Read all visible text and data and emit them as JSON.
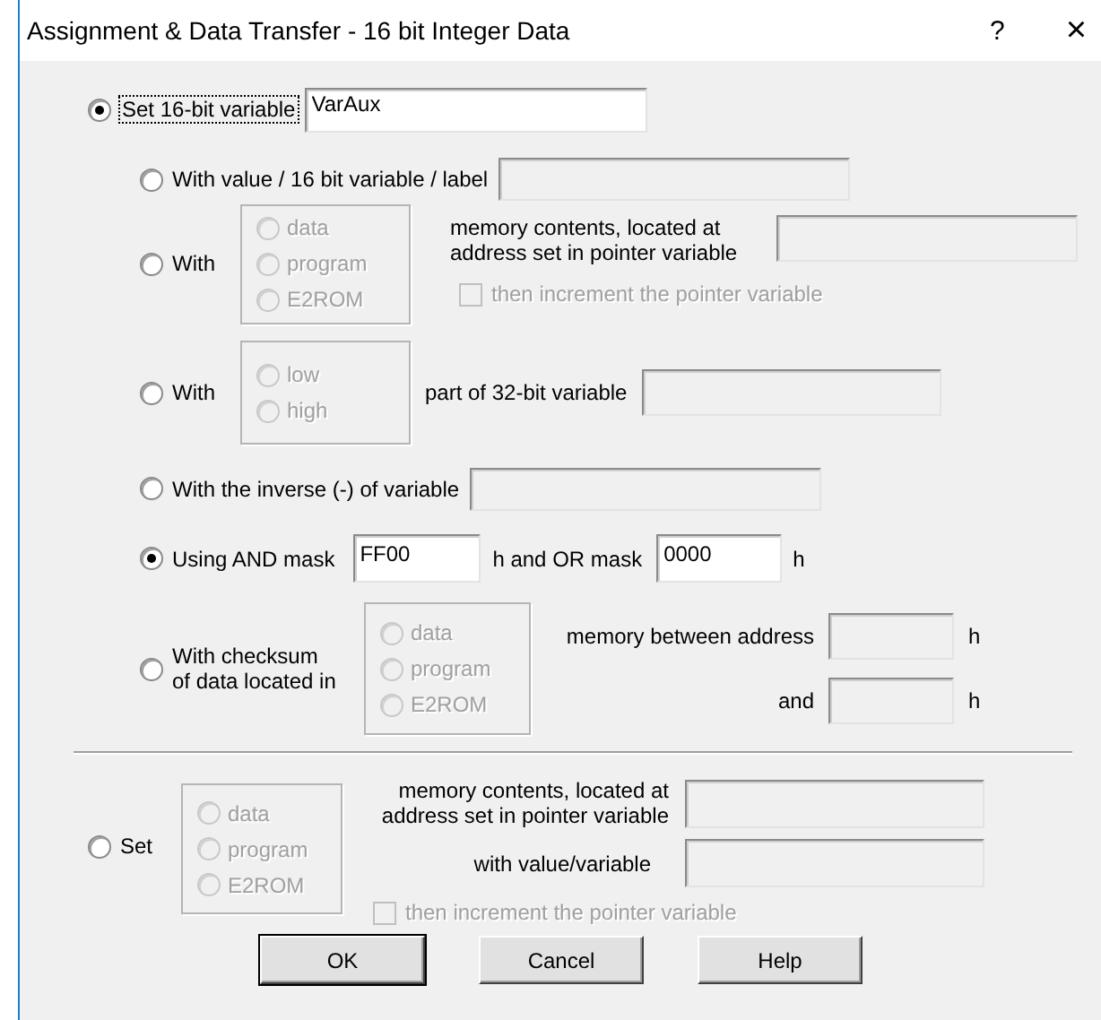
{
  "window": {
    "title": "Assignment & Data Transfer - 16 bit Integer Data",
    "help": "?",
    "close": "×"
  },
  "target": {
    "label": "Set 16-bit variable",
    "selected": true,
    "focused": true,
    "field": {
      "value": "VarAux",
      "disabled": false
    }
  },
  "options": [
    {
      "kind": "field",
      "label": "With value / 16 bit variable / label",
      "selected": false,
      "field": {
        "disabled": true
      }
    },
    {
      "kind": "pointer",
      "label": "With",
      "selected": false,
      "sources_disabled": true,
      "sources": [
        {
          "label": "data",
          "selected": false
        },
        {
          "label": "program",
          "selected": false
        },
        {
          "label": "E2ROM",
          "selected": false
        }
      ],
      "text": "memory contents, located at\naddress set in pointer variable",
      "field": {
        "disabled": true
      },
      "increment": {
        "label": "then increment the pointer variable",
        "checked": false,
        "disabled": true
      }
    },
    {
      "kind": "part",
      "label": "With",
      "selected": false,
      "sources_disabled": true,
      "sources": [
        {
          "label": "low",
          "selected": false
        },
        {
          "label": "high",
          "selected": false
        }
      ],
      "text": "part of 32-bit variable",
      "field": {
        "disabled": true
      }
    },
    {
      "kind": "field",
      "label": "With the inverse (-) of variable",
      "selected": false,
      "field": {
        "disabled": true
      }
    },
    {
      "kind": "mask",
      "label": "Using AND mask",
      "selected": true,
      "and_field": {
        "value": "FF00",
        "disabled": false
      },
      "middle": "h and OR mask",
      "or_field": {
        "value": "0000",
        "disabled": false
      },
      "suffix": "h"
    },
    {
      "kind": "checksum",
      "label": "With checksum\nof data located in",
      "selected": false,
      "sources_disabled": true,
      "sources": [
        {
          "label": "data",
          "selected": false
        },
        {
          "label": "program",
          "selected": false
        },
        {
          "label": "E2ROM",
          "selected": false
        }
      ],
      "from_label": "memory between address",
      "from_field": {
        "disabled": true
      },
      "from_suffix": "h",
      "to_label": "and",
      "to_field": {
        "disabled": true
      },
      "to_suffix": "h"
    }
  ],
  "set": {
    "label": "Set",
    "selected": false,
    "sources_disabled": true,
    "sources": [
      {
        "label": "data",
        "selected": false
      },
      {
        "label": "program",
        "selected": false
      },
      {
        "label": "E2ROM",
        "selected": false
      }
    ],
    "pointer_label": "memory contents, located at\naddress set in pointer variable",
    "pointer_field": {
      "disabled": true
    },
    "value_label": "with value/variable",
    "value_field": {
      "disabled": true
    },
    "increment": {
      "label": "then increment the pointer variable",
      "checked": false,
      "disabled": true
    }
  },
  "buttons": [
    {
      "label": "OK",
      "default": true
    },
    {
      "label": "Cancel",
      "default": false
    },
    {
      "label": "Help",
      "default": false
    }
  ]
}
